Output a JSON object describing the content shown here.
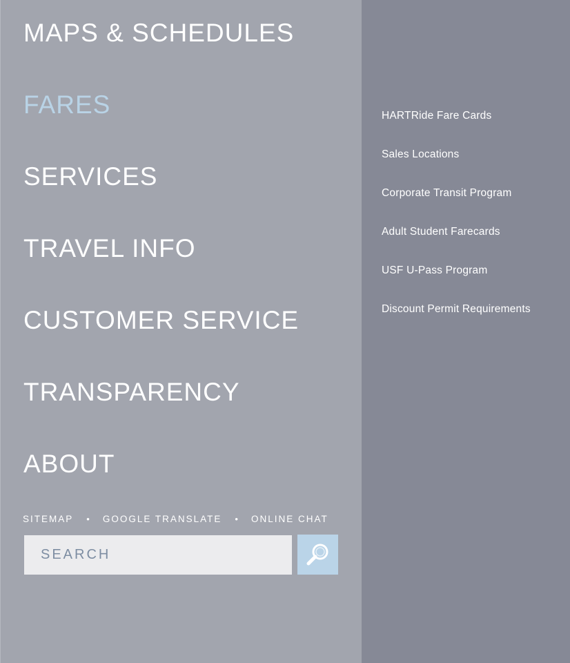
{
  "main_nav": {
    "items": [
      {
        "label": "MAPS & SCHEDULES"
      },
      {
        "label": "FARES"
      },
      {
        "label": "SERVICES"
      },
      {
        "label": "TRAVEL INFO"
      },
      {
        "label": "CUSTOMER SERVICE"
      },
      {
        "label": "TRANSPARENCY"
      },
      {
        "label": "ABOUT"
      }
    ],
    "active_item": "FARES",
    "active_color": "#b9d3e6"
  },
  "utility_links": {
    "sitemap": "SITEMAP",
    "separator": "•",
    "google_translate": "GOOGLE TRANSLATE",
    "online_chat": "ONLINE CHAT"
  },
  "search": {
    "placeholder": "SEARCH",
    "button_icon": "search-icon",
    "button_color": "#bad4e8"
  },
  "sub_nav": {
    "section": "FARES",
    "items": [
      {
        "label": "HARTRide Fare Cards"
      },
      {
        "label": "Sales Locations"
      },
      {
        "label": "Corporate Transit Program"
      },
      {
        "label": "Adult Student Farecards"
      },
      {
        "label": "USF U-Pass Program"
      },
      {
        "label": "Discount Permit Requirements"
      }
    ]
  },
  "colors": {
    "left_panel": "#a2a5ae",
    "right_panel": "#868996",
    "text": "#ffffff"
  }
}
